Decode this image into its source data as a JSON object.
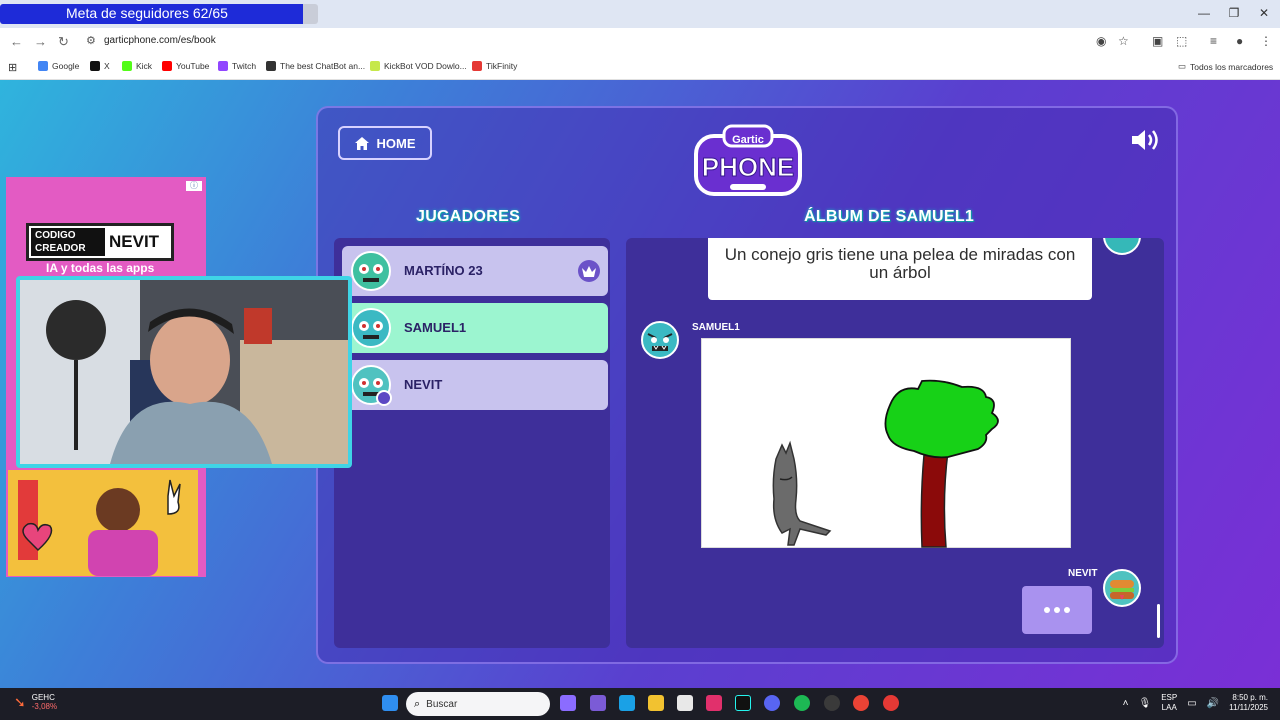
{
  "stream_overlay": {
    "follower_goal": "Meta de seguidores 62/65",
    "follower_progress": 0.954,
    "ad_creator_line1": "CODIGO",
    "ad_creator_line2": "CREADOR",
    "ad_creator_name": "NEVIT",
    "ad_tagline": "IA y todas las apps"
  },
  "browser": {
    "url": "garticphone.com/es/book",
    "bookmarks": [
      {
        "label": "Google",
        "icon": "google-icon",
        "color": "#4285f4"
      },
      {
        "label": "X",
        "icon": "x-icon",
        "color": "#111111"
      },
      {
        "label": "Kick",
        "icon": "kick-icon",
        "color": "#53fc18"
      },
      {
        "label": "YouTube",
        "icon": "youtube-icon",
        "color": "#ff0000"
      },
      {
        "label": "Twitch",
        "icon": "twitch-icon",
        "color": "#9146ff"
      },
      {
        "label": "The best ChatBot an...",
        "icon": "chatbot-icon",
        "color": "#333333"
      },
      {
        "label": "KickBot VOD Dowlo...",
        "icon": "kickbot-icon",
        "color": "#c6e84a"
      },
      {
        "label": "TikFinity",
        "icon": "tikfinity-icon",
        "color": "#e53935"
      }
    ],
    "all_bookmarks": "Todos los marcadores"
  },
  "game": {
    "home_label": "HOME",
    "logo_top": "Gartic",
    "logo_bottom": "PHONE",
    "players_title": "JUGADORES",
    "album_title": "ÁLBUM DE SAMUEL1",
    "players": [
      {
        "name": "MARTÍNO 23",
        "avatar": "hypno-avatar-icon",
        "host": true,
        "active": false
      },
      {
        "name": "SAMUEL1",
        "avatar": "monster-avatar-icon",
        "host": false,
        "active": true
      },
      {
        "name": "NEVIT",
        "avatar": "burger-avatar-icon",
        "host": false,
        "active": false
      }
    ],
    "album": {
      "caption": "Un conejo gris tiene una pelea de miradas con un árbol",
      "drawing_author": "SAMUEL1",
      "typing_author": "NEVIT"
    },
    "colors": {
      "active_player": "#9cf5d0",
      "player_bg": "#c8c3ee",
      "panel": "#3e2f9a"
    }
  },
  "taskbar": {
    "stock_name": "GEHC",
    "stock_change": "-3,08%",
    "search_label": "Buscar",
    "lang_1": "ESP",
    "lang_2": "LAA",
    "time": "8:50 p. m.",
    "date": "11/11/2025"
  }
}
